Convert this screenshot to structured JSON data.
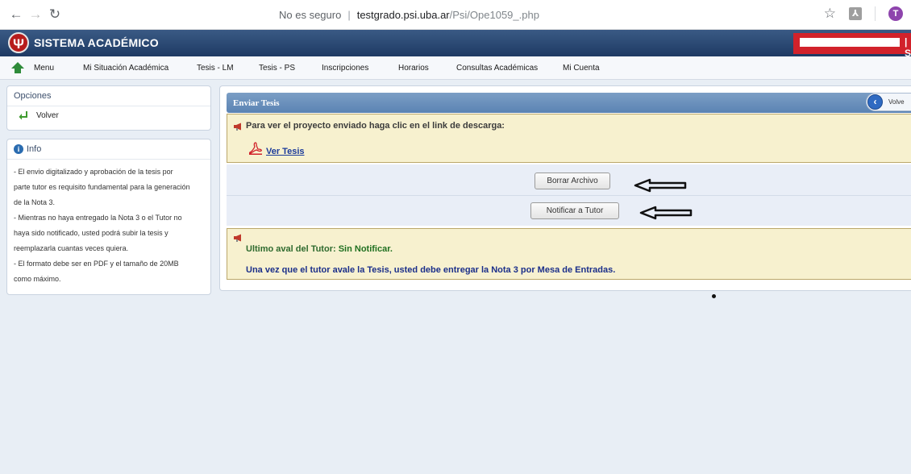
{
  "browser": {
    "security_label": "No es seguro",
    "url_host": "testgrado.psi.uba.ar",
    "url_path": "/Psi/Ope1059_.php",
    "profile_initial": "T"
  },
  "app": {
    "title": "SISTEMA ACADÉMICO",
    "logo_glyph": "Ψ"
  },
  "menu": {
    "items": [
      "Menu",
      "Mi Situación Académica",
      "Tesis - LM",
      "Tesis - PS",
      "Inscripciones",
      "Horarios",
      "Consultas Académicas",
      "Mi Cuenta"
    ]
  },
  "sidebar": {
    "opciones_title": "Opciones",
    "volver_label": "Volver",
    "info_title": "Info",
    "info_lines": [
      "- El envio digitalizado y aprobación de la tesis por",
      "parte tutor es requisito fundamental para la generación",
      "de la Nota 3.",
      "- Mientras no haya entregado la Nota 3 o el Tutor no",
      "haya sido notificado, usted podrá subir la tesis y",
      "reemplazarla cuantas veces quiera.",
      "- El formato debe ser en PDF y el tamaño de 20MB",
      "como máximo."
    ]
  },
  "main": {
    "title": "Enviar Tesis",
    "volver_label": "Volve",
    "download_text": "Para ver el proyecto enviado haga clic en el link de descarga:",
    "ver_tesis_label": "Ver Tesis",
    "borrar_label": "Borrar Archivo",
    "notificar_label": "Notificar a Tutor",
    "aval_label": "Ultimo aval del Tutor:",
    "aval_value": "Sin Notificar.",
    "nota3_text": "Una vez que el tutor avale la Tesis, usted debe entregar la Nota 3 por Mesa de Entradas."
  },
  "colors": {
    "header_blue": "#1e3a63",
    "panel_header_blue": "#5b83b3",
    "note_yellow": "#f7f1cf",
    "alert_red": "#d2222b"
  }
}
